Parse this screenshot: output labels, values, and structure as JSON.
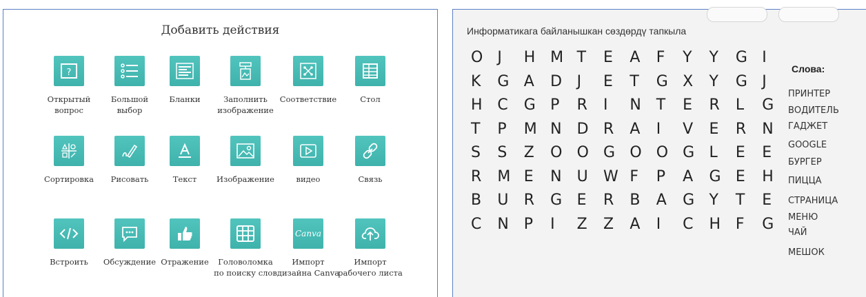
{
  "left_panel": {
    "title": "Добавить действия",
    "tiles": [
      {
        "label": "Открытый\nвопрос",
        "icon": "question-box-icon"
      },
      {
        "label": "Большой\nвыбор",
        "icon": "multiple-choice-list-icon"
      },
      {
        "label": "Бланки",
        "icon": "fill-blanks-icon"
      },
      {
        "label": "Заполнить\nизображение",
        "icon": "fill-image-icon"
      },
      {
        "label": "Соответствие",
        "icon": "matching-icon"
      },
      {
        "label": "Стол",
        "icon": "table-icon"
      },
      {
        "label": "Сортировка",
        "icon": "sorting-icon"
      },
      {
        "label": "Рисовать",
        "icon": "pencil-draw-icon"
      },
      {
        "label": "Текст",
        "icon": "text-a-icon"
      },
      {
        "label": "Изображение",
        "icon": "image-icon"
      },
      {
        "label": "видео",
        "icon": "video-play-icon"
      },
      {
        "label": "Связь",
        "icon": "link-chain-icon"
      },
      {
        "label": "Встроить",
        "icon": "embed-code-icon"
      },
      {
        "label": "Обсуждение",
        "icon": "discussion-bubble-icon"
      },
      {
        "label": "Отражение",
        "icon": "thumbs-up-icon"
      },
      {
        "label": "Головоломка\nпо поиску слов",
        "icon": "word-search-grid-icon"
      },
      {
        "label": "Импорт\nдизайна Canva",
        "icon": "canva-logo",
        "logo_text": "Canva"
      },
      {
        "label": "Импорт\nрабочего листа",
        "icon": "cloud-upload-icon"
      }
    ]
  },
  "right_panel": {
    "instruction": "Информатикага байланышкан сөздөрдү тапкыла",
    "grid": [
      [
        "O",
        "J",
        "H",
        "M",
        "T",
        "E",
        "A",
        "F",
        "Y",
        "Y",
        "G",
        "I"
      ],
      [
        "K",
        "G",
        "A",
        "D",
        "J",
        "E",
        "T",
        "G",
        "X",
        "Y",
        "G",
        "J"
      ],
      [
        "H",
        "C",
        "G",
        "P",
        "R",
        "I",
        "N",
        "T",
        "E",
        "R",
        "L",
        "G"
      ],
      [
        "T",
        "P",
        "M",
        "N",
        "D",
        "R",
        "A",
        "I",
        "V",
        "E",
        "R",
        "N"
      ],
      [
        "S",
        "S",
        "Z",
        "O",
        "O",
        "G",
        "O",
        "O",
        "G",
        "L",
        "E",
        "E"
      ],
      [
        "R",
        "M",
        "E",
        "N",
        "U",
        "W",
        "F",
        "P",
        "A",
        "G",
        "E",
        "H"
      ],
      [
        "B",
        "U",
        "R",
        "G",
        "E",
        "R",
        "B",
        "A",
        "G",
        "Y",
        "T",
        "E"
      ],
      [
        "C",
        "N",
        "P",
        "I",
        "Z",
        "Z",
        "A",
        "I",
        "C",
        "H",
        "F",
        "G"
      ]
    ],
    "words_title": "Слова:",
    "words": [
      "ПРИНТЕР",
      "ВОДИТЕЛЬ",
      "ГАДЖЕТ",
      "GOOGLE",
      "БУРГЕР",
      "ПИЦЦА",
      "СТРАНИЦА",
      "МЕНЮ",
      "ЧАЙ",
      "МЕШОК"
    ]
  },
  "colors": {
    "tile": "#48bab4",
    "border": "#5b7fc4"
  }
}
